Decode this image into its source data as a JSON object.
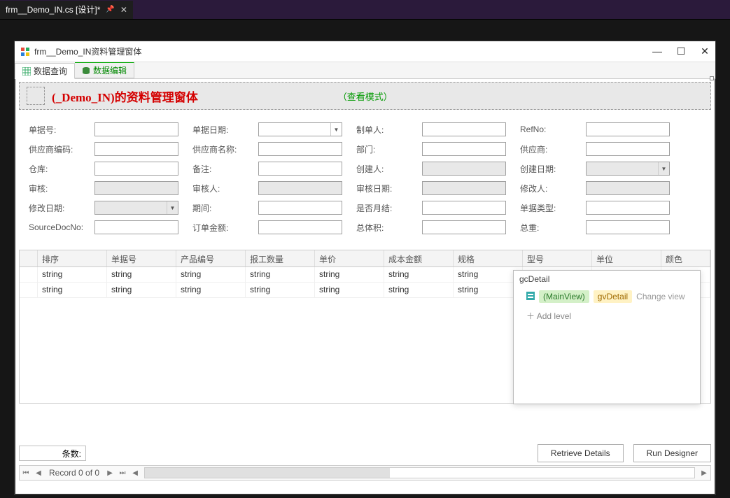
{
  "vs_tab": "frm__Demo_IN.cs [设计]*",
  "win": {
    "title": "frm__Demo_IN资料管理窗体"
  },
  "tabs": {
    "query": "数据查询",
    "edit": "数据编辑"
  },
  "header": {
    "title": "(_Demo_IN)的资料管理窗体",
    "mode": "（查看模式）"
  },
  "fields": {
    "r0": [
      "单据号:",
      "单据日期:",
      "制单人:",
      "RefNo:"
    ],
    "r1": [
      "供应商编码:",
      "供应商名称:",
      "部门:",
      "供应商:"
    ],
    "r2": [
      "仓库:",
      "备注:",
      "创建人:",
      "创建日期:"
    ],
    "r3": [
      "审核:",
      "审核人:",
      "审核日期:",
      "修改人:"
    ],
    "r4": [
      "修改日期:",
      "期间:",
      "是否月结:",
      "单据类型:"
    ],
    "r5": [
      "SourceDocNo:",
      "订单金额:",
      "总体积:",
      "总重:"
    ]
  },
  "grid": {
    "cols": [
      "排序",
      "单据号",
      "产品编号",
      "报工数量",
      "单价",
      "成本金额",
      "规格",
      "型号",
      "单位",
      "颜色"
    ],
    "rows": [
      [
        "string",
        "string",
        "string",
        "string",
        "string",
        "string",
        "string",
        "",
        "",
        ""
      ],
      [
        "string",
        "string",
        "string",
        "string",
        "string",
        "string",
        "string",
        "",
        "",
        ""
      ]
    ]
  },
  "designerPop": {
    "title": "gcDetail",
    "main": "(MainView)",
    "gv": "gvDetail",
    "change": "Change view",
    "add": "Add level"
  },
  "footer": {
    "count_label": "条数:",
    "retrieve": "Retrieve Details",
    "run": "Run Designer"
  },
  "nav": {
    "text": "Record 0 of 0"
  }
}
